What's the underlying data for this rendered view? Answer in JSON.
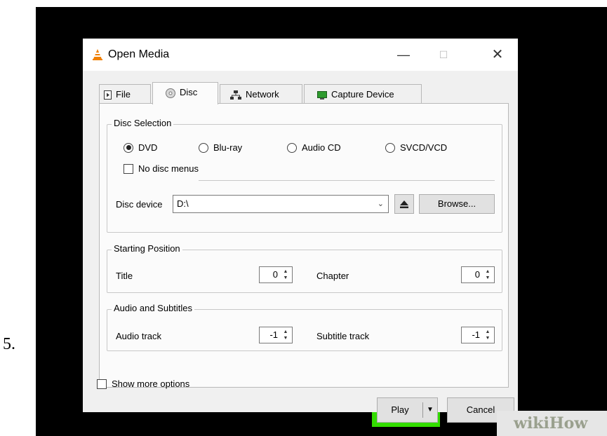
{
  "step": {
    "number": "5."
  },
  "window": {
    "title": "Open Media",
    "controls": {
      "minimize": "—",
      "maximize": "☐",
      "close": "✕"
    }
  },
  "tabs": [
    {
      "label": "File",
      "icon": "file-icon"
    },
    {
      "label": "Disc",
      "icon": "disc-icon",
      "active": true
    },
    {
      "label": "Network",
      "icon": "network-icon"
    },
    {
      "label": "Capture Device",
      "icon": "capture-device-icon"
    }
  ],
  "disc_selection": {
    "title": "Disc Selection",
    "options": [
      {
        "label": "DVD",
        "selected": true
      },
      {
        "label": "Blu-ray",
        "selected": false
      },
      {
        "label": "Audio CD",
        "selected": false
      },
      {
        "label": "SVCD/VCD",
        "selected": false
      }
    ],
    "no_disc_menus": {
      "label": "No disc menus",
      "checked": false
    },
    "device_label": "Disc device",
    "device_value": "D:\\",
    "eject_icon": "eject-icon",
    "browse_label": "Browse..."
  },
  "starting_position": {
    "title": "Starting Position",
    "title_label": "Title",
    "title_value": "0",
    "chapter_label": "Chapter",
    "chapter_value": "0"
  },
  "audio_subtitles": {
    "title": "Audio and Subtitles",
    "audio_label": "Audio track",
    "audio_value": "-1",
    "subtitle_label": "Subtitle track",
    "subtitle_value": "-1"
  },
  "footer": {
    "show_more_options": "Show more options",
    "play_label": "Play",
    "cancel_label": "Cancel"
  },
  "watermark": {
    "brand": "wikiHow"
  },
  "colors": {
    "highlight": "#33dd00",
    "vlc_orange": "#f08000"
  }
}
